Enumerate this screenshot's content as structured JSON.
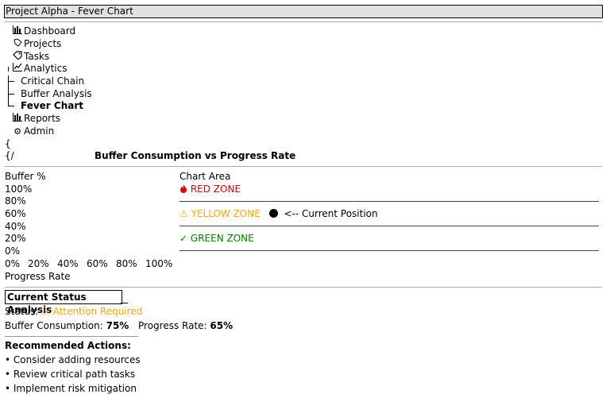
{
  "window": {
    "title": "Project Alpha - Fever Chart"
  },
  "nav": {
    "items": [
      {
        "label": "Dashboard",
        "icon": "bar-chart-icon"
      },
      {
        "label": "Projects",
        "icon": "folder-icon"
      },
      {
        "label": "Tasks",
        "icon": "tag-icon"
      },
      {
        "label": "Analytics",
        "icon": "line-chart-icon"
      },
      {
        "label": "Critical Chain"
      },
      {
        "label": "Buffer Analysis"
      },
      {
        "label": "Fever Chart",
        "selected": true
      },
      {
        "label": "Reports",
        "icon": "bar-chart-icon"
      },
      {
        "label": "Admin",
        "icon": "gear-icon"
      }
    ],
    "brace_open": "{",
    "brace_close": "{/"
  },
  "chart_title": "Buffer Consumption vs Progress Rate",
  "chart_data": {
    "type": "scatter",
    "title": "Buffer Consumption vs Progress Rate",
    "ylabel": "Buffer %",
    "xlabel": "Progress Rate",
    "y_ticks": [
      "100%",
      "80%",
      "60%",
      "40%",
      "20%",
      "0%"
    ],
    "x_ticks": [
      "0%",
      "20%",
      "40%",
      "60%",
      "80%",
      "100%"
    ],
    "area_label": "Chart Area",
    "zones": [
      {
        "name": "RED ZONE",
        "color": "#e00000"
      },
      {
        "name": "YELLOW ZONE",
        "color": "#ffa500"
      },
      {
        "name": "GREEN ZONE",
        "color": "#008000"
      }
    ],
    "marker_label": "<-- Current Position",
    "points": [
      {
        "x": 65,
        "y": 75
      }
    ]
  },
  "status": {
    "section_title": "Current Status Analysis",
    "status_label": "Status:",
    "status_value": "Attention Required",
    "buffer_label": "Buffer Consumption:",
    "buffer_value": "75%",
    "progress_label": "Progress Rate:",
    "progress_value": "65%"
  },
  "actions": {
    "title": "Recommended Actions:",
    "items": [
      "• Consider adding resources",
      "• Review critical path tasks",
      "• Implement risk mitigation"
    ]
  },
  "colors": {
    "red": "#e00000",
    "yellow": "#ffa500",
    "green": "#008000"
  }
}
